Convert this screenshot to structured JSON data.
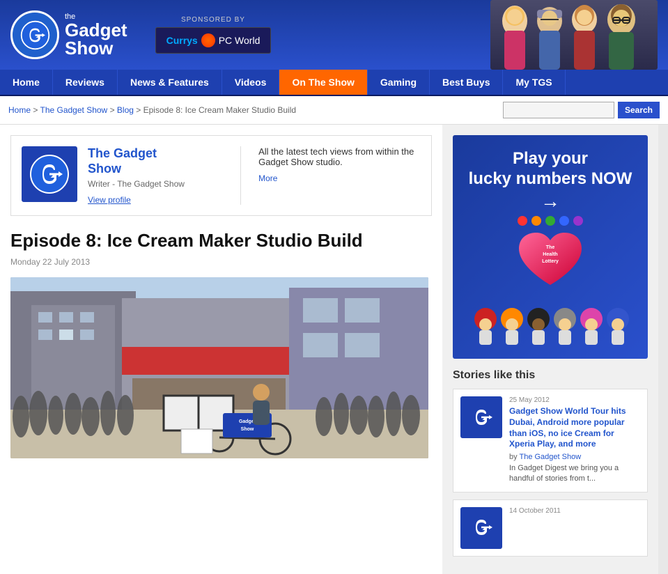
{
  "header": {
    "logo_circle_letter": "G",
    "site_name_the": "the",
    "site_name_gadget": "Gadget",
    "site_name_show": "Show",
    "sponsored_by_label": "SPONSORED BY",
    "sponsor_name": "Currys PC World"
  },
  "nav": {
    "items": [
      {
        "label": "Home",
        "active": false
      },
      {
        "label": "Reviews",
        "active": false
      },
      {
        "label": "News & Features",
        "active": false
      },
      {
        "label": "Videos",
        "active": false
      },
      {
        "label": "On The Show",
        "active": true
      },
      {
        "label": "Gaming",
        "active": false
      },
      {
        "label": "Best Buys",
        "active": false
      },
      {
        "label": "My TGS",
        "active": false
      }
    ]
  },
  "breadcrumb": {
    "home": "Home",
    "gadget_show": "The Gadget Show",
    "blog": "Blog",
    "current": "Episode 8: Ice Cream Maker Studio Build"
  },
  "search": {
    "placeholder": "",
    "button_label": "Search"
  },
  "author": {
    "name_line1": "The Gadget",
    "name_line2": "Show",
    "role": "Writer - The Gadget Show",
    "view_profile": "View profile",
    "description": "All the latest tech views from within the Gadget Show studio.",
    "more_label": "More"
  },
  "article": {
    "title": "Episode 8: Ice Cream Maker Studio Build",
    "date": "Monday 22 July 2013"
  },
  "ad": {
    "title_line1": "Play your",
    "title_line2": "lucky numbers NOW",
    "arrow": "→",
    "lottery_label_line1": "The",
    "lottery_label_line2": "Health",
    "lottery_label_line3": "Lottery"
  },
  "sidebar": {
    "stories_header": "Stories like this",
    "stories": [
      {
        "date": "25 May 2012",
        "title": "Gadget Show World Tour hits Dubai, Android more popular than iOS, no ice Cream for Xperia Play, and more",
        "author_prefix": "by ",
        "author": "The Gadget Show",
        "excerpt": "In Gadget Digest we bring you a handful of stories from t..."
      },
      {
        "date": "14 October 2011",
        "title": "",
        "author_prefix": "",
        "author": "",
        "excerpt": ""
      }
    ]
  }
}
